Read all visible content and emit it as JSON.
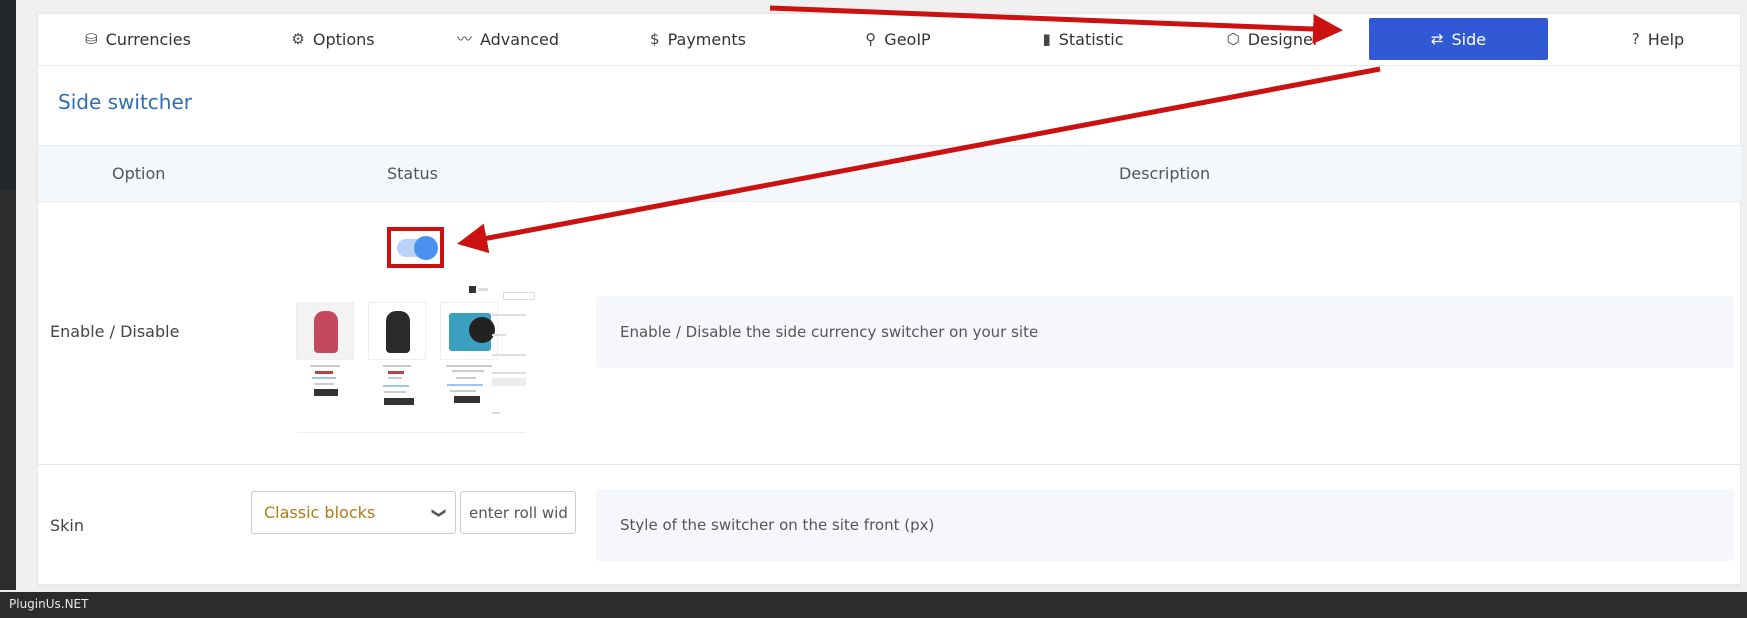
{
  "tabs": [
    {
      "label": "Currencies",
      "icon": "cubes-icon",
      "glyph": "⛁",
      "active": false
    },
    {
      "label": "Options",
      "icon": "gear-icon",
      "glyph": "⚙",
      "active": false
    },
    {
      "label": "Advanced",
      "icon": "wave-icon",
      "glyph": "〰",
      "active": false
    },
    {
      "label": "Payments",
      "icon": "dollar-icon",
      "glyph": "$",
      "active": false
    },
    {
      "label": "GeoIP",
      "icon": "map-pin-icon",
      "glyph": "⚲",
      "active": false
    },
    {
      "label": "Statistic",
      "icon": "bar-chart-icon",
      "glyph": "▮",
      "active": false
    },
    {
      "label": "Designer",
      "icon": "box-icon",
      "glyph": "⬡",
      "active": false
    },
    {
      "label": "Side",
      "icon": "exchange-icon",
      "glyph": "⇄",
      "active": true
    },
    {
      "label": "Help",
      "icon": "question-circle-icon",
      "glyph": "?",
      "active": false
    }
  ],
  "section_title": "Side switcher",
  "table": {
    "col_option": "Option",
    "col_status": "Status",
    "col_description": "Description"
  },
  "rows": {
    "enable": {
      "label": "Enable / Disable",
      "toggle_on": true,
      "description": "Enable / Disable the side currency switcher on your site"
    },
    "skin": {
      "label": "Skin",
      "select_value": "Classic blocks",
      "input_placeholder": "enter roll width",
      "description": "Style of the switcher on the site front (px)"
    }
  },
  "footer_text": "PluginUs.NET",
  "colors": {
    "active_tab": "#3159d6",
    "title": "#2f6db5",
    "arrow": "#cc1111",
    "select_text": "#b07a15"
  }
}
